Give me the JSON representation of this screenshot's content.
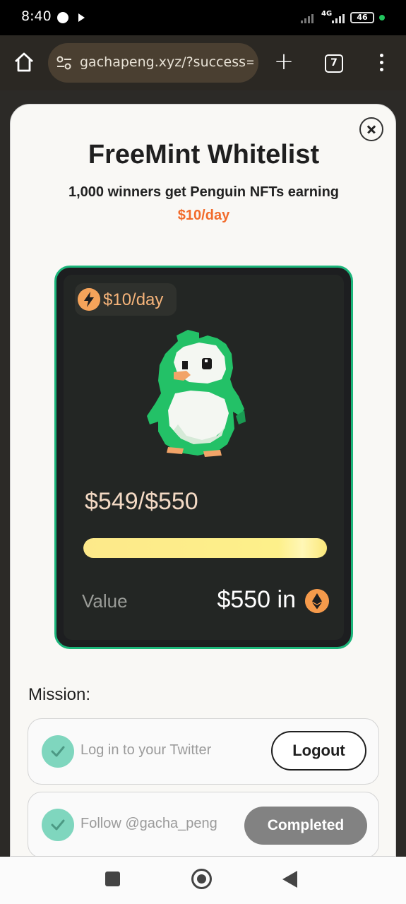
{
  "status_bar": {
    "time": "8:40",
    "network": "4G",
    "battery": "46",
    "icons": [
      "messenger-icon",
      "play-icon",
      "signal-icon",
      "battery-icon"
    ]
  },
  "browser": {
    "url": "gachapeng.xyz/?success=",
    "tab_count": "7",
    "icons": [
      "home-icon",
      "site-settings-icon",
      "new-tab-icon",
      "tabs-icon",
      "more-menu-icon"
    ]
  },
  "modal": {
    "title": "FreeMint Whitelist",
    "subtitle": "1,000 winners get Penguin NFTs earning",
    "subtitle_accent": "$10/day",
    "close_icon": "close-icon"
  },
  "nft_card": {
    "badge": "$10/day",
    "progress_text": "$549/$550",
    "progress_fraction": 0.998,
    "value_label": "Value",
    "value_amount": "$550 in",
    "colors": {
      "border": "#1bb57a",
      "accent": "#f5a35a",
      "progress": "#fde98a"
    }
  },
  "mission": {
    "label": "Mission:",
    "tasks": [
      {
        "text": "Log in to your Twitter",
        "button": "Logout"
      },
      {
        "text": "Follow @gacha_peng",
        "button": "Completed"
      }
    ]
  },
  "navbar": {
    "icons": [
      "recents-icon",
      "home-icon",
      "back-icon"
    ]
  }
}
